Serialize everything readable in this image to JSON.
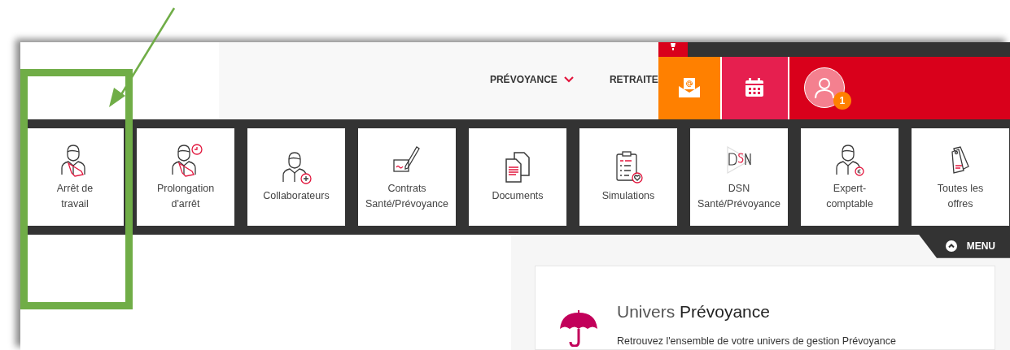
{
  "header": {
    "nav": [
      {
        "label": "PRÉVOYANCE",
        "kind": "dropdown"
      },
      {
        "label": "RETRAITE",
        "kind": "link"
      }
    ],
    "notification_badge": "1"
  },
  "tiles": [
    {
      "lines": [
        "Arrêt de",
        "travail"
      ],
      "kind": "sling"
    },
    {
      "lines": [
        "Prolongation",
        "d'arrêt"
      ],
      "kind": "sling-clock"
    },
    {
      "lines": [
        "Collaborateurs"
      ],
      "kind": "person-plus"
    },
    {
      "lines": [
        "Contrats",
        "Santé/Prévoyance"
      ],
      "kind": "signature"
    },
    {
      "lines": [
        "Documents"
      ],
      "kind": "documents"
    },
    {
      "lines": [
        "Simulations"
      ],
      "kind": "clipboard"
    },
    {
      "lines": [
        "DSN",
        "Santé/Prévoyance"
      ],
      "kind": "dsn"
    },
    {
      "lines": [
        "Expert-",
        "comptable"
      ],
      "kind": "person-euro"
    },
    {
      "lines": [
        "Toutes les",
        "offres"
      ],
      "kind": "tags"
    }
  ],
  "menu_toggle": {
    "label": "MENU"
  },
  "card": {
    "title": "Univers **Prévoyance**",
    "description": "Retrouvez l'ensemble de votre univers de gestion Prévoyance"
  }
}
